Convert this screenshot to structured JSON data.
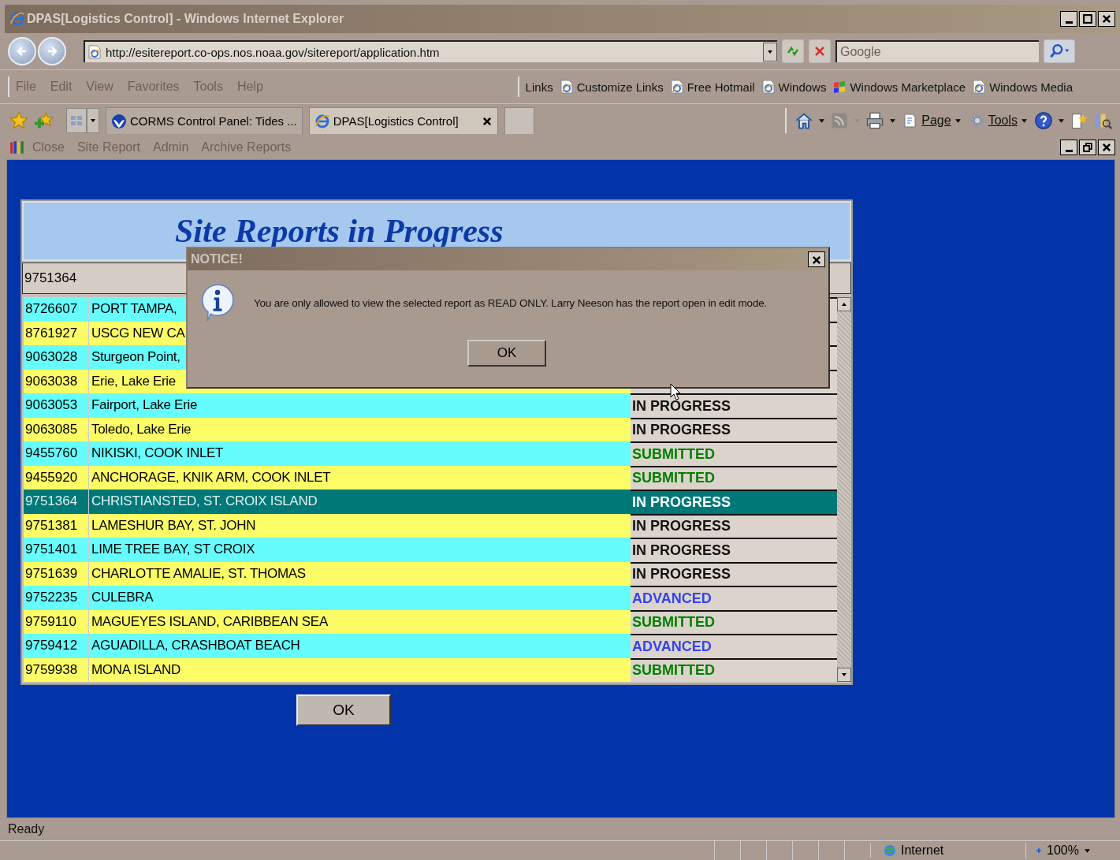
{
  "window": {
    "title": "DPAS[Logistics Control] - Windows Internet Explorer"
  },
  "address_bar": {
    "url": "http://esitereport.co-ops.nos.noaa.gov/sitereport/application.htm",
    "search_placeholder": "Google"
  },
  "menu": [
    "File",
    "Edit",
    "View",
    "Favorites",
    "Tools",
    "Help"
  ],
  "links": {
    "label": "Links",
    "items": [
      {
        "label": "Customize Links",
        "kind": "page"
      },
      {
        "label": "Free Hotmail",
        "kind": "page"
      },
      {
        "label": "Windows",
        "kind": "page"
      },
      {
        "label": "Windows Marketplace",
        "kind": "flag"
      },
      {
        "label": "Windows Media",
        "kind": "page"
      }
    ]
  },
  "tabs": [
    {
      "label": "CORMS Control Panel: Tides ...",
      "kind": "agency",
      "selected": false
    },
    {
      "label": "DPAS[Logistics Control]",
      "kind": "page",
      "selected": true
    }
  ],
  "command_bar": [
    {
      "label": "Page",
      "kind": "page"
    },
    {
      "label": "Tools",
      "kind": "gear"
    }
  ],
  "app_menu": [
    "Close",
    "Site Report",
    "Admin",
    "Archive Reports"
  ],
  "report": {
    "title": "Site Reports in Progress",
    "selected_id": "9751364",
    "ok_button": "OK",
    "rows": [
      {
        "id": "8726607",
        "name": "PORT TAMPA,",
        "selected": false
      },
      {
        "id": "8761927",
        "name": "USCG NEW CA",
        "selected": false
      },
      {
        "id": "9063028",
        "name": "Sturgeon Point,",
        "selected": false
      },
      {
        "id": "9063038",
        "name": "Erie, Lake Erie",
        "selected": false
      },
      {
        "id": "9063053",
        "name": "Fairport, Lake Erie",
        "status": {
          "text": "IN PROGRESS",
          "kind": "in_progress"
        },
        "selected": false
      },
      {
        "id": "9063085",
        "name": "Toledo, Lake Erie",
        "status": {
          "text": "IN PROGRESS",
          "kind": "in_progress"
        },
        "selected": false
      },
      {
        "id": "9455760",
        "name": "NIKISKI, COOK INLET",
        "status": {
          "text": "SUBMITTED",
          "kind": "submitted"
        },
        "selected": false
      },
      {
        "id": "9455920",
        "name": "ANCHORAGE, KNIK ARM, COOK INLET",
        "status": {
          "text": "SUBMITTED",
          "kind": "submitted"
        },
        "selected": false
      },
      {
        "id": "9751364",
        "name": "CHRISTIANSTED, ST. CROIX ISLAND",
        "status": {
          "text": "IN PROGRESS",
          "kind": "in_progress"
        },
        "selected": true
      },
      {
        "id": "9751381",
        "name": "LAMESHUR BAY, ST. JOHN",
        "status": {
          "text": "IN PROGRESS",
          "kind": "in_progress"
        },
        "selected": false
      },
      {
        "id": "9751401",
        "name": "LIME TREE BAY, ST CROIX",
        "status": {
          "text": "IN PROGRESS",
          "kind": "in_progress"
        },
        "selected": false
      },
      {
        "id": "9751639",
        "name": "CHARLOTTE AMALIE, ST. THOMAS",
        "status": {
          "text": "IN PROGRESS",
          "kind": "in_progress"
        },
        "selected": false
      },
      {
        "id": "9752235",
        "name": "CULEBRA",
        "status": {
          "text": "ADVANCED",
          "kind": "advanced"
        },
        "selected": false
      },
      {
        "id": "9759110",
        "name": "MAGUEYES ISLAND, CARIBBEAN SEA",
        "status": {
          "text": "SUBMITTED",
          "kind": "submitted"
        },
        "selected": false
      },
      {
        "id": "9759412",
        "name": "AGUADILLA, CRASHBOAT BEACH",
        "status": {
          "text": "ADVANCED",
          "kind": "advanced"
        },
        "selected": false
      },
      {
        "id": "9759938",
        "name": "MONA ISLAND",
        "status": {
          "text": "SUBMITTED",
          "kind": "submitted"
        },
        "selected": false
      }
    ]
  },
  "dialog": {
    "title": "NOTICE!",
    "message": "You are only allowed to view the selected report as READ ONLY. Larry Neeson has the report open in edit mode.",
    "button": "OK"
  },
  "status_bar": {
    "text": "Ready",
    "zone": "Internet",
    "zoom": "100%"
  }
}
